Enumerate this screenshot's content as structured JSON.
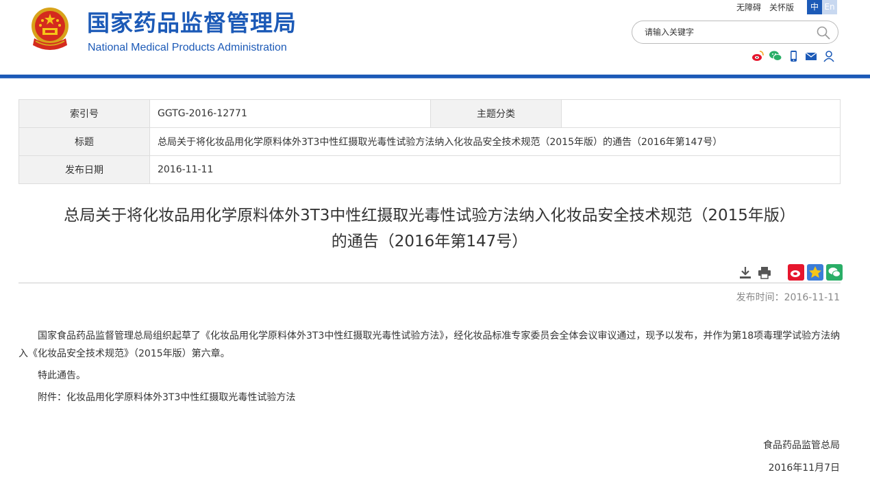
{
  "header": {
    "org_name_cn": "国家药品监督管理局",
    "org_name_en": "National Medical Products Administration",
    "links": [
      "无障碍",
      "关怀版"
    ],
    "lang_zh": "中",
    "lang_en": "En",
    "search_placeholder": "请输入关键字",
    "social_icons": [
      "weibo-icon",
      "wechat-icon",
      "mobile-icon",
      "mail-icon",
      "user-icon"
    ],
    "brand_color": "#1c5ab7"
  },
  "info_table": {
    "index_label": "索引号",
    "index_value": "GGTG-2016-12771",
    "category_label": "主题分类",
    "category_value": "",
    "title_label": "标题",
    "title_value": "总局关于将化妆品用化学原料体外3T3中性红摄取光毒性试验方法纳入化妆品安全技术规范（2015年版）的通告（2016年第147号）",
    "date_label": "发布日期",
    "date_value": "2016-11-11"
  },
  "article": {
    "title_line1": "总局关于将化妆品用化学原料体外3T3中性红摄取光毒性试验方法纳入化妆品安全技术规范（2015年版）",
    "title_line2": "的通告（2016年第147号）",
    "publish_time": "发布时间：2016-11-11",
    "paragraphs": [
      "国家食品药品监督管理总局组织起草了《化妆品用化学原料体外3T3中性红摄取光毒性试验方法》，经化妆品标准专家委员会全体会议审议通过，现予以发布，并作为第18项毒理学试验方法纳入《化妆品安全技术规范》（2015年版）第六章。",
      "特此通告。",
      "附件：化妆品用化学原料体外3T3中性红摄取光毒性试验方法"
    ],
    "signature": "食品药品监管总局",
    "sign_date": "2016年11月7日"
  }
}
